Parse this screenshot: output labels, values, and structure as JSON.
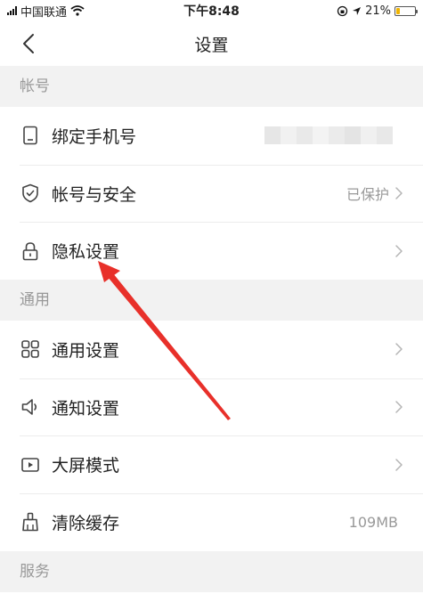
{
  "status_bar": {
    "carrier": "中国联通",
    "time": "下午8:48",
    "battery": "21%",
    "battery_level": 0.21,
    "icons": [
      "signal-icon",
      "wifi-icon",
      "orientation-lock-icon",
      "location-icon",
      "battery-icon"
    ]
  },
  "nav": {
    "title": "设置",
    "back_icon": "chevron-left-icon"
  },
  "sections": {
    "account": {
      "header": "帐号",
      "items": [
        {
          "label": "绑定手机号",
          "icon": "phone-icon"
        },
        {
          "label": "帐号与安全",
          "value": "已保护",
          "icon": "shield-check-icon"
        },
        {
          "label": "隐私设置",
          "icon": "lock-icon"
        }
      ]
    },
    "general": {
      "header": "通用",
      "items": [
        {
          "label": "通用设置",
          "icon": "grid-icon"
        },
        {
          "label": "通知设置",
          "icon": "speaker-icon"
        },
        {
          "label": "大屏模式",
          "icon": "play-screen-icon"
        },
        {
          "label": "清除缓存",
          "value": "109MB",
          "icon": "broom-icon"
        }
      ]
    },
    "services": {
      "header": "服务"
    }
  },
  "colors": {
    "background": "#f2f2f2",
    "row_background": "#ffffff",
    "muted_text": "#999999",
    "annotation": "#e8302a",
    "battery": "#f0b400"
  }
}
